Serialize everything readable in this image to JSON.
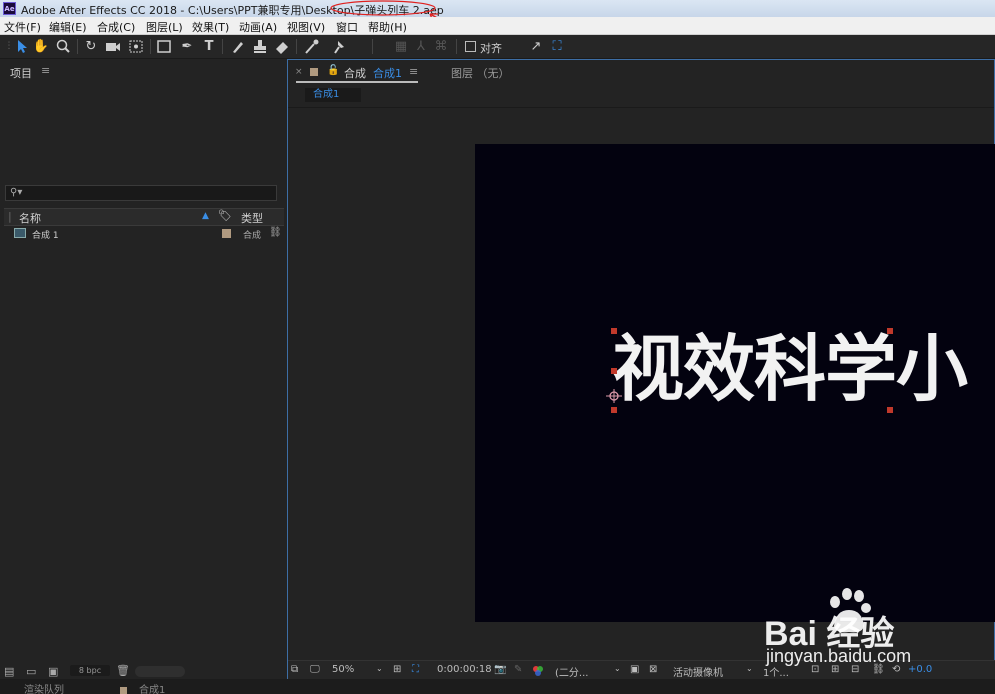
{
  "window": {
    "logo": "Ae",
    "title": "Adobe After Effects CC 2018 - C:\\Users\\PPT兼职专用\\Desktop\\子弹头列车 2.aep"
  },
  "menu": [
    "文件(F)",
    "编辑(E)",
    "合成(C)",
    "图层(L)",
    "效果(T)",
    "动画(A)",
    "视图(V)",
    "窗口",
    "帮助(H)"
  ],
  "toolbar": {
    "tools": [
      "selection-tool",
      "hand-tool",
      "zoom-tool",
      "rotate-tool",
      "camera-tool",
      "pan-behind-tool",
      "rectangle-tool",
      "pen-tool",
      "text-tool",
      "brush-tool",
      "clone-stamp-tool",
      "eraser-tool",
      "roto-brush-tool",
      "puppet-pin-tool"
    ],
    "snap_label": "对齐"
  },
  "project_panel": {
    "title": "项目",
    "columns": {
      "name": "名称",
      "type": "类型"
    },
    "items": [
      {
        "name": "合成 1",
        "type": "合成"
      }
    ],
    "bpc": "8 bpc"
  },
  "comp_viewer": {
    "tab_prefix": "合成",
    "tab_name": "合成1",
    "layer_tab": "图层 （无）",
    "breadcrumb": "合成1",
    "canvas_text": "视效科学小",
    "zoom": "50%",
    "timecode": "0:00:00:18",
    "resolution": "(二分...",
    "camera": "活动摄像机",
    "views": "1个...",
    "exposure": "+0.0"
  },
  "bottom": {
    "left": "渲染队列",
    "right": "合成1"
  },
  "watermark": {
    "brand": "Bai  经验",
    "url": "jingyan.baidu.com"
  },
  "colors": {
    "accent": "#3a8ee6",
    "annotation": "#e0201e",
    "canvas_bg": "#03020f"
  }
}
